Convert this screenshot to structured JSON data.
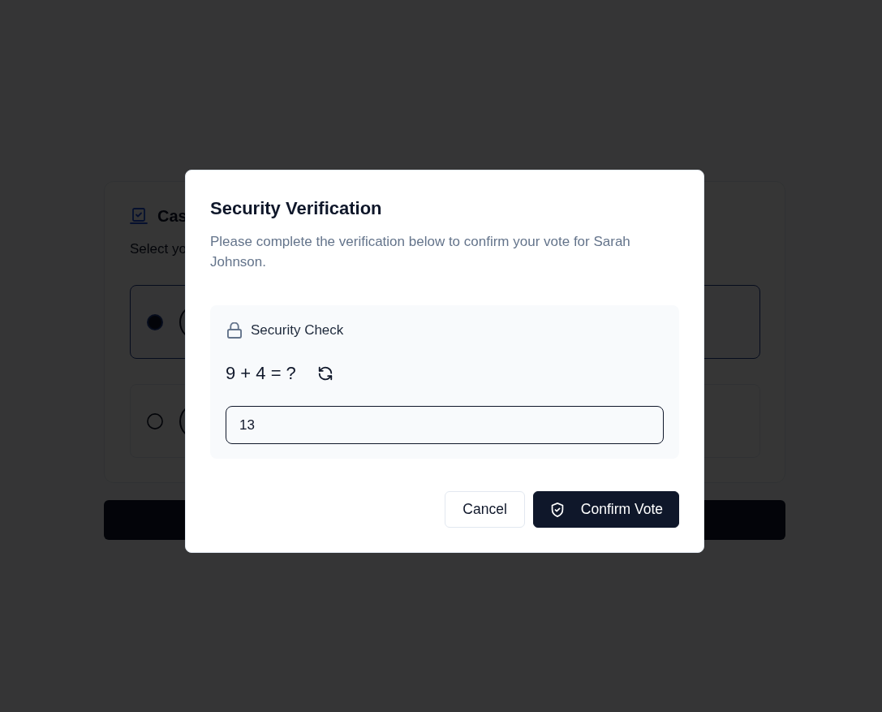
{
  "background": {
    "title": "Cas",
    "subtitle": "Select yo",
    "options": [
      {
        "selected": true
      },
      {
        "selected": false
      }
    ]
  },
  "dialog": {
    "title": "Security Verification",
    "description": "Please complete the verification below to confirm your vote for Sarah Johnson.",
    "check": {
      "label": "Security Check",
      "question": "9 + 4 = ?",
      "answer": "13"
    },
    "buttons": [
      {
        "kind": "secondary",
        "label": "Cancel"
      },
      {
        "kind": "primary",
        "label": "Confirm Vote"
      }
    ]
  }
}
